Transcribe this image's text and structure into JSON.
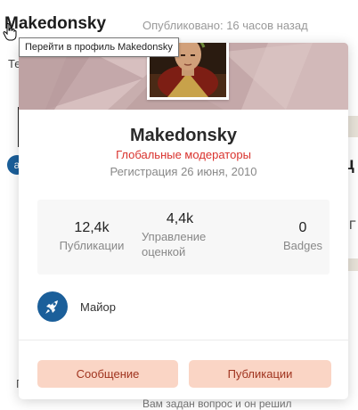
{
  "background": {
    "author_name": "Makedonsky",
    "post_meta": "Опубликовано: 16 часов назад",
    "partial_text_left": "Те",
    "avatar_letter": "a",
    "partial_heading_right": "ц",
    "partial_text_right": "Г",
    "partial_text_bottom_left": "П",
    "partial_text_bottom": "Вам задан вопрос и он решил"
  },
  "tooltip": {
    "text": "Перейти в профиль Makedonsky"
  },
  "profile_card": {
    "name": "Makedonsky",
    "group": "Глобальные модераторы",
    "registration": "Регистрация 26 июня, 2010",
    "stats": [
      {
        "value": "12,4k",
        "label": "Публикации"
      },
      {
        "value": "4,4k",
        "label": "Управление оценкой"
      },
      {
        "value": "0",
        "label": "Badges"
      }
    ],
    "rank": {
      "icon": "rocket-icon",
      "label": "Майор"
    },
    "buttons": {
      "message": "Сообщение",
      "publications": "Публикации"
    }
  },
  "colors": {
    "group_color": "#d9322d",
    "button_bg": "#fad5c5",
    "button_text": "#a0341f",
    "rank_badge": "#1b5f9a"
  }
}
